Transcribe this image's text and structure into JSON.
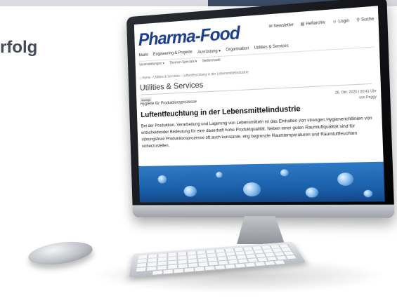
{
  "heading_fragment": "rfolg",
  "site": {
    "logo": "Pharma-Food",
    "utility_nav": [
      {
        "label": "Newsletter",
        "icon": "mail-icon"
      },
      {
        "label": "Heftarchiv",
        "icon": "archive-icon"
      },
      {
        "label": "Login",
        "icon": "user-icon"
      },
      {
        "label": "Suche",
        "icon": "search-icon"
      }
    ],
    "main_nav": [
      "Markt",
      "Engineering & Projekte",
      "Ausrüstung ▾",
      "Organisation",
      "Utilities & Services"
    ],
    "sub_nav": [
      "Veranstaltungen ▾",
      "Themen-Specials ▾",
      "Stellenmarkt"
    ],
    "breadcrumb": "⌂  Home › Utilities & Services › Luftentfeuchtung in der Lebensmittelindustrie",
    "section_title": "Utilities & Services",
    "article": {
      "badge": "Anzeige",
      "kicker": "Hygiene für Produktionsprozesse",
      "date": "26. Okt. 2020 | 00:41 Uhr",
      "author": "von Peggy",
      "title": "Luftentfeuchtung in der Lebensmittelindustrie",
      "body": "Bei der Produktion, Verarbeitung und Lagerung von Lebensmitteln ist das Einhalten von strengen Hygienerichtlinien von entscheidender Bedeutung für eine dauerhaft hohe Produktqualität. Neben einer guten Raumluftqualität sind für störungsfreie Produktionsprozesse oft auch konstante, eng begrenzte Raumtemperaturen und Raumluftfeuchten sicherzustellen."
    }
  },
  "colors": {
    "logo": "#1d3f8a",
    "hero": "#1a5ea8",
    "headline": "#444a55"
  }
}
